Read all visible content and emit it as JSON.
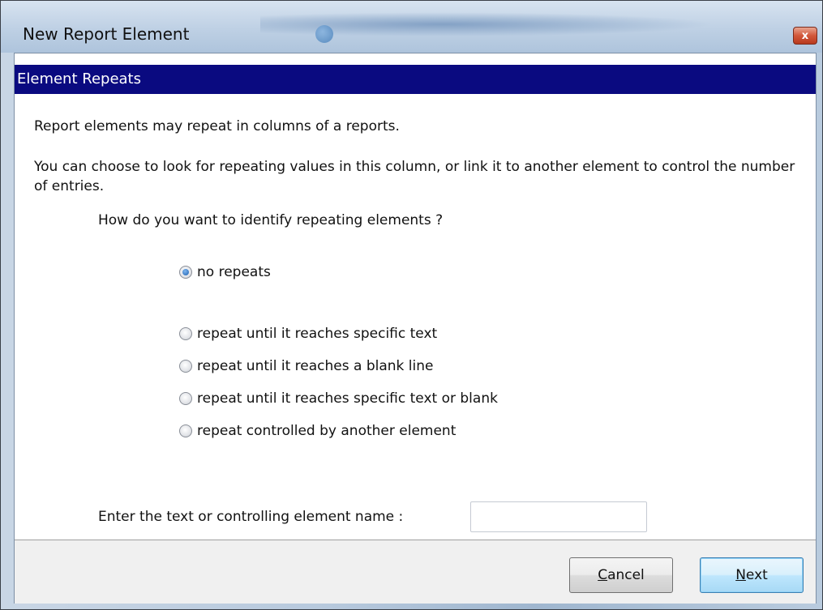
{
  "window": {
    "title": "New Report Element",
    "close_glyph": "x"
  },
  "section": {
    "header": "Element Repeats"
  },
  "content": {
    "intro": "Report elements may repeat in columns of a reports.",
    "description": "You can choose to look for repeating values in this column, or link it to another element to control the number of entries.",
    "question": "How do you want to identify repeating elements ?",
    "options": [
      {
        "label": "no repeats",
        "checked": true
      },
      {
        "label": "repeat until it reaches specific text",
        "checked": false
      },
      {
        "label": "repeat until it reaches a blank line",
        "checked": false
      },
      {
        "label": "repeat until it reaches specific text or blank",
        "checked": false
      },
      {
        "label": "repeat controlled by another element",
        "checked": false
      }
    ],
    "entry_label": "Enter the text or controlling element name :",
    "entry_value": ""
  },
  "buttons": {
    "cancel_mnemonic": "C",
    "cancel_rest": "ancel",
    "next_mnemonic": "N",
    "next_rest": "ext"
  }
}
